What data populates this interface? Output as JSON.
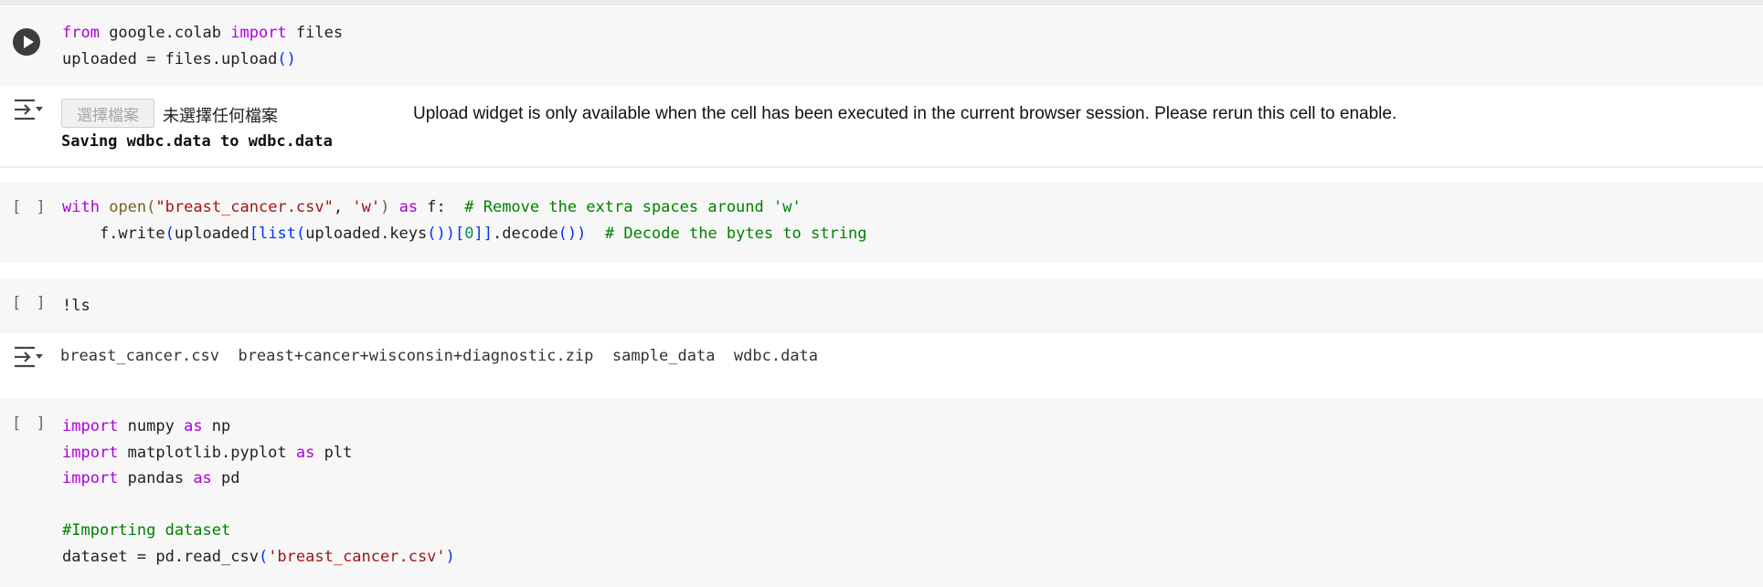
{
  "cell1": {
    "line1": {
      "t1": "from",
      "t2": " google.colab ",
      "t3": "import",
      "t4": " files"
    },
    "line2": {
      "t1": "uploaded = files.upload",
      "t2": "()"
    }
  },
  "output1": {
    "file_button": "選擇檔案",
    "no_file": "未選擇任何檔案",
    "message": "Upload widget is only available when the cell has been executed in the current browser session. Please rerun this cell to enable.",
    "saving": "Saving wdbc.data to wdbc.data"
  },
  "cell2": {
    "brackets": "[ ]",
    "line1": {
      "t1": "with",
      "t2": " ",
      "t3": "open",
      "t4": "(",
      "t5": "\"breast_cancer.csv\"",
      "t6": ", ",
      "t7": "'w'",
      "t8": ")",
      "t9": " ",
      "t10": "as",
      "t11": " f:  ",
      "t12": "# Remove the extra spaces around 'w'"
    },
    "line2": {
      "t1": "    f.write",
      "t2": "(",
      "t3": "uploaded",
      "t4": "[",
      "t5": "list",
      "t6": "(",
      "t7": "uploaded.keys",
      "t8": "()",
      "t9": ")",
      "t10": "[",
      "t11": "0",
      "t12": "]",
      "t13": "]",
      "t14": ".decode",
      "t15": "()",
      "t16": ")",
      "t17": "  ",
      "t18": "# Decode the bytes to string"
    }
  },
  "cell3": {
    "brackets": "[ ]",
    "line1": "!ls"
  },
  "output3": {
    "text": "breast_cancer.csv  breast+cancer+wisconsin+diagnostic.zip  sample_data  wdbc.data"
  },
  "cell4": {
    "brackets": "[ ]",
    "line1": {
      "t1": "import",
      "t2": " numpy ",
      "t3": "as",
      "t4": " np"
    },
    "line2": {
      "t1": "import",
      "t2": " matplotlib.pyplot ",
      "t3": "as",
      "t4": " plt"
    },
    "line3": {
      "t1": "import",
      "t2": " pandas ",
      "t3": "as",
      "t4": " pd"
    },
    "line5": "#Importing dataset",
    "line6": {
      "t1": "dataset = pd.read_csv",
      "t2": "(",
      "t3": "'breast_cancer.csv'",
      "t4": ")"
    }
  },
  "icons": {
    "run": "play-circle-icon",
    "output": "output-toggle-icon"
  }
}
